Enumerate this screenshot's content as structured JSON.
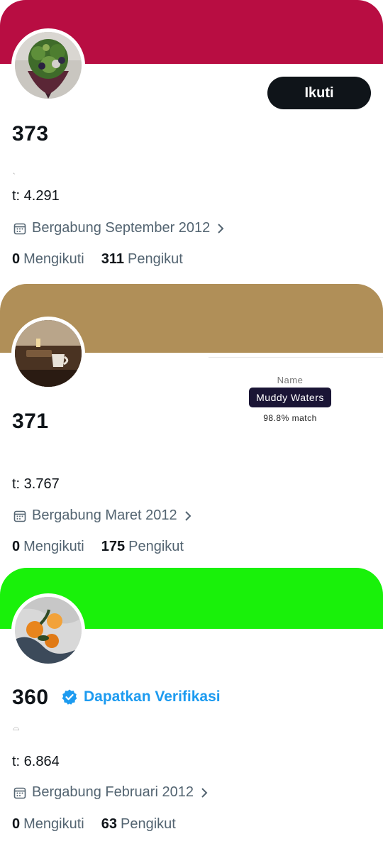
{
  "profiles": [
    {
      "banner_color": "#b80d42",
      "avatar": "bouquet-photo",
      "follow_label": "Ikuti",
      "count": "373",
      "faint": "ˎ",
      "stat_t": "t: 4.291",
      "joined": "Bergabung September 2012",
      "following_count": "0",
      "following_label": "Mengikuti",
      "followers_count": "311",
      "followers_label": "Pengikut"
    },
    {
      "banner_color": "#b08f58",
      "avatar": "table-photo",
      "count": "371",
      "stat_t": "t: 3.767",
      "joined": "Bergabung Maret 2012",
      "following_count": "0",
      "following_label": "Mengikuti",
      "followers_count": "175",
      "followers_label": "Pengikut",
      "match_panel": {
        "label": "Name",
        "name": "Muddy Waters",
        "match": "98.8% match"
      }
    },
    {
      "banner_color": "#19f10a",
      "avatar": "oranges-photo",
      "count": "360",
      "verify_label": "Dapatkan Verifikasi",
      "faint": "⌓",
      "stat_t": "t: 6.864",
      "joined": "Bergabung Februari 2012",
      "following_count": "0",
      "following_label": "Mengikuti",
      "followers_count": "63",
      "followers_label": "Pengikut"
    }
  ]
}
